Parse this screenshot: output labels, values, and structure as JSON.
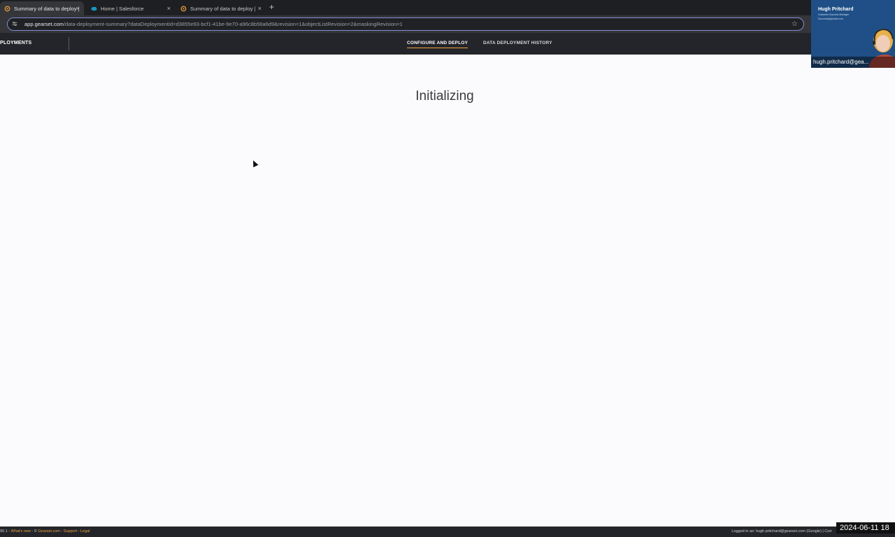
{
  "browser": {
    "tabs": [
      {
        "label": "Summary of data to deploy |",
        "icon": "gearset-icon",
        "active": true
      },
      {
        "label": "Home | Salesforce",
        "icon": "salesforce-cloud-icon",
        "active": false
      },
      {
        "label": "Summary of data to deploy |",
        "icon": "gearset-icon",
        "active": false
      }
    ],
    "close_glyph": "×",
    "new_tab_glyph": "+",
    "address": {
      "host": "app.gearset.com",
      "path": "/data-deployment-summary?dataDeploymentId=d3855e93-bcf1-41be-9e70-a96c8b56a6d9&revision=1&objectListRevision=2&maskingRevision=1"
    }
  },
  "app": {
    "brand": "PLOYMENTS",
    "nav_tabs": [
      {
        "label": "CONFIGURE AND DEPLOY",
        "active": true
      },
      {
        "label": "DATA DEPLOYMENT HISTORY",
        "active": false
      }
    ],
    "accent_color": "#f2a33a"
  },
  "main": {
    "status": "Initializing"
  },
  "footer": {
    "version": "90.1",
    "separator": "-",
    "whats_new": "What's new",
    "copyright": "©",
    "gearset": "Gearset.com",
    "support": "Support",
    "legal": "Legal",
    "logged_in": "Logged in as: hugh.pritchard@gearset.com (Google) | Curr"
  },
  "timestamp": "2024-06-11 18",
  "video_overlay": {
    "name": "Hugh Pritchard",
    "role": "Customer Success Manager",
    "email": "Success@gearset.com",
    "label": "hugh.pritchard@gea..."
  }
}
